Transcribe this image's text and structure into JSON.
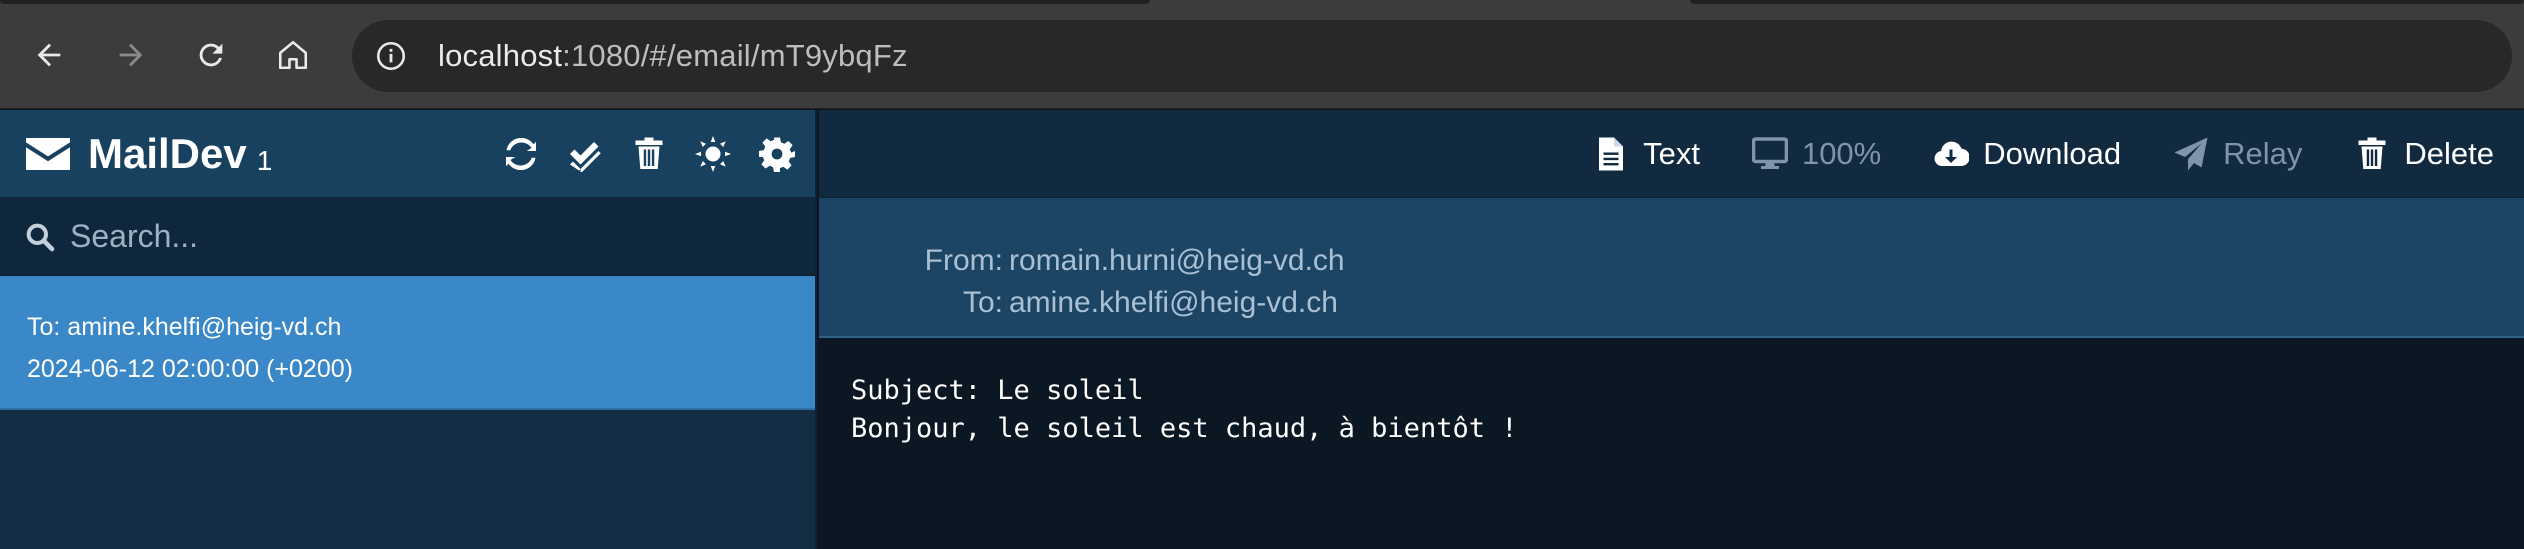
{
  "browser": {
    "url_host": "localhost",
    "url_rest": ":1080/#/email/mT9ybqFz",
    "icons": [
      "back-arrow-icon",
      "forward-arrow-icon",
      "reload-icon",
      "home-icon",
      "site-info-icon"
    ]
  },
  "sidebar": {
    "app_title": "MailDev",
    "mail_count": "1",
    "tools": [
      "refresh-icon",
      "mark-all-read-icon",
      "trash-icon",
      "theme-icon",
      "settings-icon"
    ],
    "search": {
      "placeholder": "Search..."
    },
    "emails": [
      {
        "to": "To: amine.khelfi@heig-vd.ch",
        "date": "2024-06-12 02:00:00 (+0200)"
      }
    ]
  },
  "toolbar": {
    "text_label": "Text",
    "zoom_label": "100%",
    "download_label": "Download",
    "relay_label": "Relay",
    "delete_label": "Delete"
  },
  "headers": {
    "from_label": "From:",
    "from_value": "romain.hurni@heig-vd.ch",
    "to_label": "To:",
    "to_value": "amine.khelfi@heig-vd.ch"
  },
  "message": {
    "subject_line": "Subject: Le soleil",
    "body_line": "Bonjour, le soleil est chaud, à bientôt !"
  },
  "colors": {
    "sidebar_bg": "#132d44",
    "selected_item": "#3a88c8",
    "header_bg": "#1c4565",
    "body_bg": "#0b1722"
  }
}
